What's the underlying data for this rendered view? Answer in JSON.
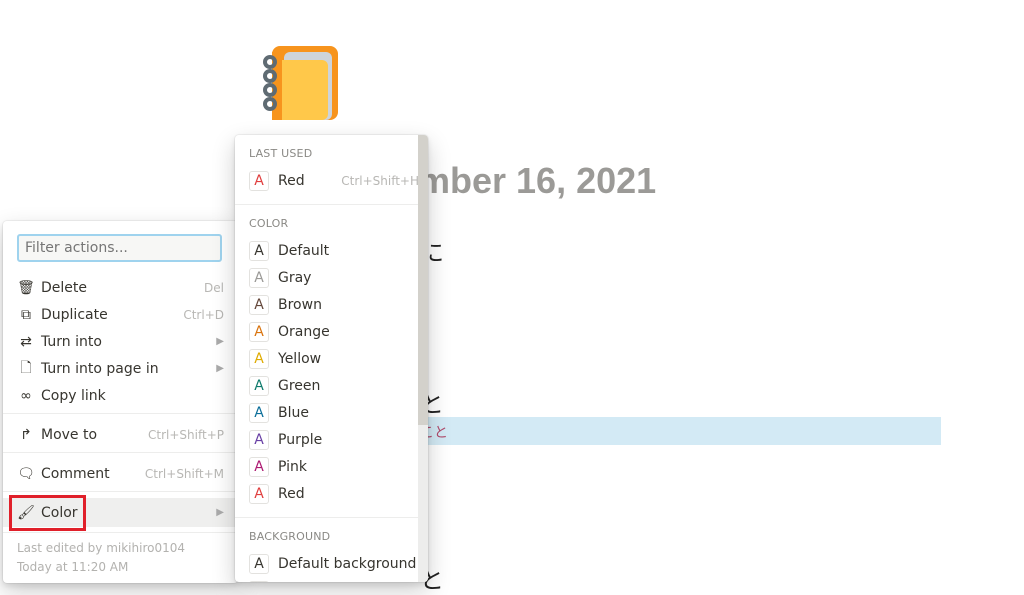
{
  "page": {
    "title_fragment": "mber 16, 2021",
    "frag1": "に",
    "frag2": "と",
    "highlight_text": "こと",
    "frag3": "と"
  },
  "menu": {
    "filter_placeholder": "Filter actions...",
    "items": [
      {
        "label": "Delete",
        "shortcut": "Del",
        "icon": "trash-icon"
      },
      {
        "label": "Duplicate",
        "shortcut": "Ctrl+D",
        "icon": "duplicate-icon"
      },
      {
        "label": "Turn into",
        "shortcut": "▶",
        "icon": "turn-into-icon"
      },
      {
        "label": "Turn into page in",
        "shortcut": "▶",
        "icon": "page-icon"
      },
      {
        "label": "Copy link",
        "shortcut": "",
        "icon": "link-icon"
      },
      {
        "label": "Move to",
        "shortcut": "Ctrl+Shift+P",
        "icon": "move-icon"
      },
      {
        "label": "Comment",
        "shortcut": "Ctrl+Shift+M",
        "icon": "comment-icon"
      },
      {
        "label": "Color",
        "shortcut": "▶",
        "icon": "paint-roller-icon"
      }
    ],
    "footer_line1": "Last edited by mikihiro0104",
    "footer_line2": "Today at 11:20 AM"
  },
  "color_menu": {
    "last_used_header": "LAST USED",
    "last_used": {
      "label": "Red",
      "shortcut": "Ctrl+Shift+H",
      "color": "#e03e3e"
    },
    "color_header": "COLOR",
    "glyph": "A",
    "colors": [
      {
        "label": "Default",
        "color": "#37352f"
      },
      {
        "label": "Gray",
        "color": "#9b9a97"
      },
      {
        "label": "Brown",
        "color": "#64473a"
      },
      {
        "label": "Orange",
        "color": "#d9730d"
      },
      {
        "label": "Yellow",
        "color": "#dfab01"
      },
      {
        "label": "Green",
        "color": "#0f7b6c"
      },
      {
        "label": "Blue",
        "color": "#0b6e99"
      },
      {
        "label": "Purple",
        "color": "#6940a5"
      },
      {
        "label": "Pink",
        "color": "#ad1a72"
      },
      {
        "label": "Red",
        "color": "#e03e3e"
      }
    ],
    "background_header": "BACKGROUND",
    "backgrounds": [
      {
        "label": "Default background",
        "color": "#37352f"
      }
    ]
  }
}
